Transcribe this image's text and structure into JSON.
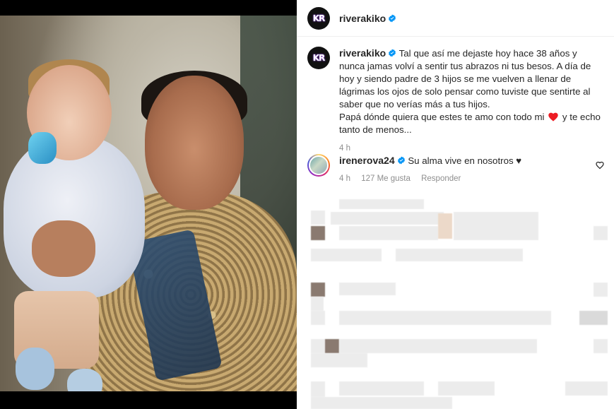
{
  "post": {
    "author": "riverakiko",
    "avatar_text": "KR",
    "verified": true,
    "caption_line1": "Tal que así me dejaste hoy hace 38 años y nunca jamas volví a sentir tus abrazos ni tus besos. A día de hoy y siendo padre de 3 hijos se me vuelven a llenar de lágrimas los ojos de solo pensar como tuviste que sentirte al saber que no verías más a tus hijos.",
    "caption_line2_before": "Papá dónde quiera que estes te amo con todo mi",
    "caption_line2_after": "y te echo tanto de menos...",
    "time": "4 h"
  },
  "comments": [
    {
      "author": "irenerova24",
      "verified": true,
      "text": "Su alma vive en nosotros ♥",
      "time": "4 h",
      "likes": "127 Me gusta",
      "reply_label": "Responder"
    }
  ],
  "icons": {
    "verified": "verified-badge-icon",
    "heart_red": "red-heart-icon",
    "like": "heart-outline-icon"
  },
  "colors": {
    "verified": "#0095f6",
    "heart": "#ed1c24",
    "meta_text": "#8e8e8e"
  }
}
